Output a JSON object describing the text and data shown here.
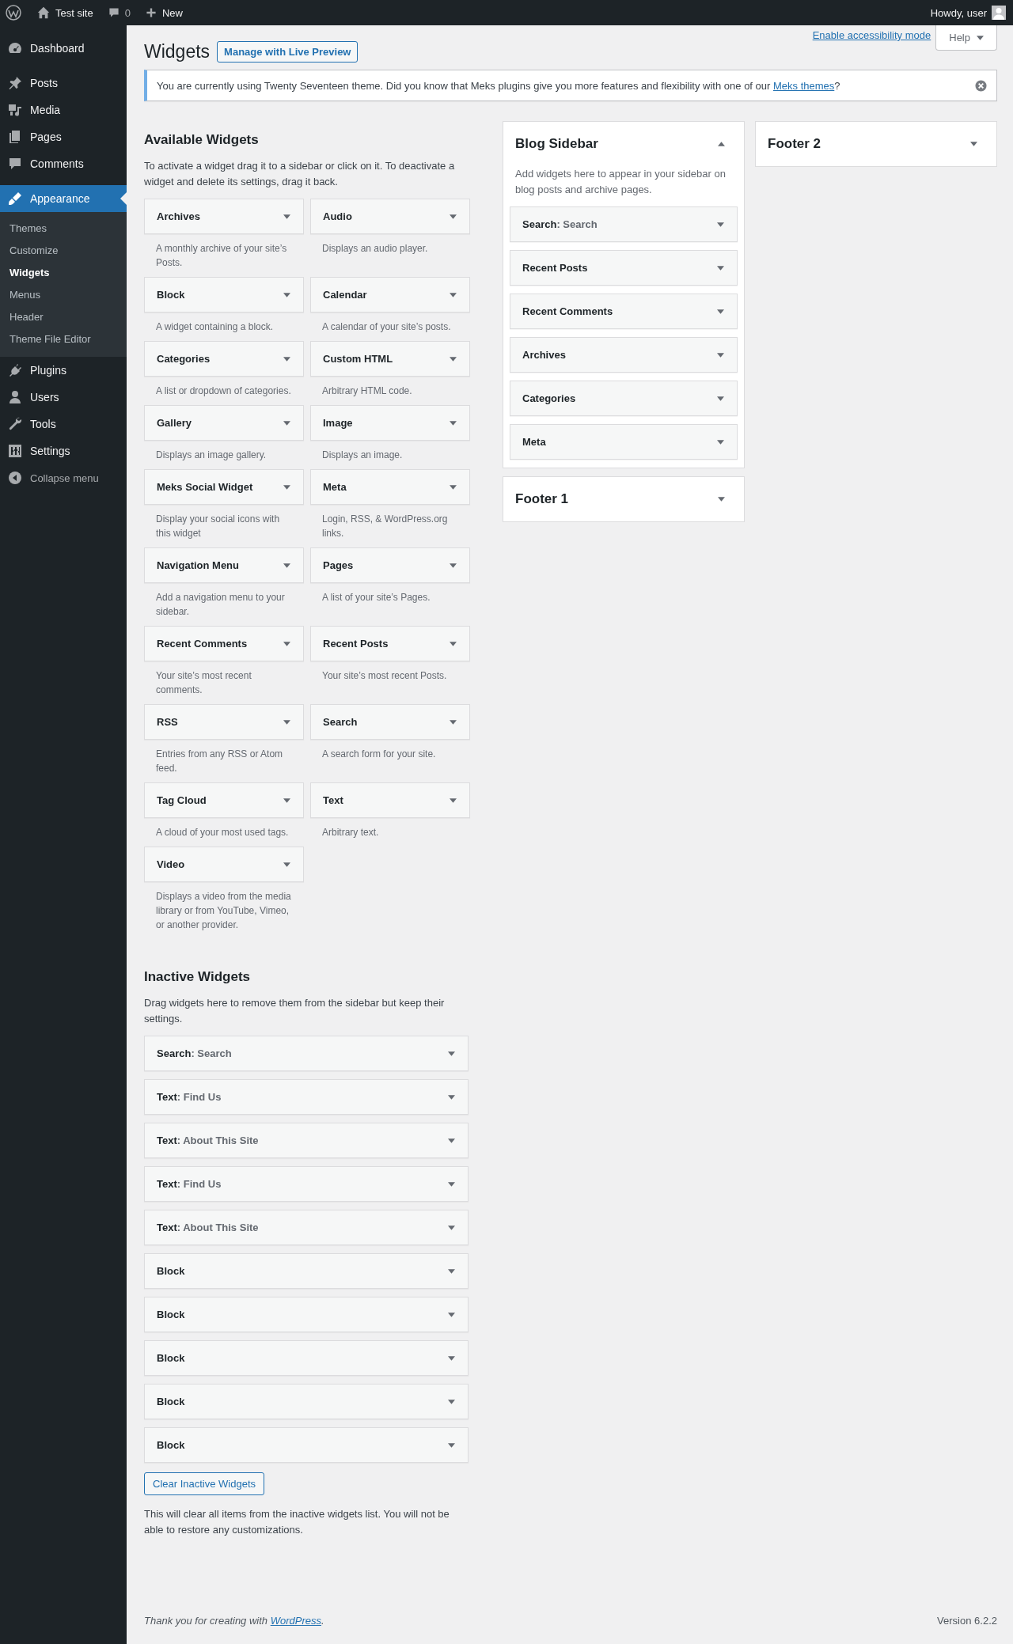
{
  "admin_bar": {
    "site_name": "Test site",
    "comments_count": "0",
    "new_label": "New",
    "greeting": "Howdy, user"
  },
  "admin_menu": {
    "items": [
      {
        "label": "Dashboard",
        "selected": false
      },
      {
        "label": "Posts",
        "selected": false
      },
      {
        "label": "Media",
        "selected": false
      },
      {
        "label": "Pages",
        "selected": false
      },
      {
        "label": "Comments",
        "selected": false
      },
      {
        "label": "Appearance",
        "selected": true,
        "children": [
          {
            "label": "Themes",
            "selected": false
          },
          {
            "label": "Customize",
            "selected": false
          },
          {
            "label": "Widgets",
            "selected": true
          },
          {
            "label": "Menus",
            "selected": false
          },
          {
            "label": "Header",
            "selected": false
          },
          {
            "label": "Theme File Editor",
            "selected": false
          }
        ]
      },
      {
        "label": "Plugins",
        "selected": false
      },
      {
        "label": "Users",
        "selected": false
      },
      {
        "label": "Tools",
        "selected": false
      },
      {
        "label": "Settings",
        "selected": false
      }
    ],
    "collapse_label": "Collapse menu"
  },
  "screen_links": {
    "accessibility_link": "Enable accessibility mode",
    "help_button": "Help"
  },
  "page": {
    "title": "Widgets",
    "live_preview_button": "Manage with Live Preview"
  },
  "notice": {
    "text_before": "You are currently using Twenty Seventeen theme. Did you know that Meks plugins give you more features and flexibility with one of our ",
    "link": "Meks themes",
    "text_after": "?"
  },
  "available": {
    "heading": "Available Widgets",
    "description": "To activate a widget drag it to a sidebar or click on it. To deactivate a widget and delete its settings, drag it back.",
    "widgets": [
      {
        "title": "Archives",
        "description": "A monthly archive of your site’s Posts."
      },
      {
        "title": "Audio",
        "description": "Displays an audio player."
      },
      {
        "title": "Block",
        "description": "A widget containing a block."
      },
      {
        "title": "Calendar",
        "description": "A calendar of your site’s posts."
      },
      {
        "title": "Categories",
        "description": "A list or dropdown of categories."
      },
      {
        "title": "Custom HTML",
        "description": "Arbitrary HTML code."
      },
      {
        "title": "Gallery",
        "description": "Displays an image gallery."
      },
      {
        "title": "Image",
        "description": "Displays an image."
      },
      {
        "title": "Meks Social Widget",
        "description": "Display your social icons with this widget"
      },
      {
        "title": "Meta",
        "description": "Login, RSS, & WordPress.org links."
      },
      {
        "title": "Navigation Menu",
        "description": "Add a navigation menu to your sidebar."
      },
      {
        "title": "Pages",
        "description": "A list of your site’s Pages."
      },
      {
        "title": "Recent Comments",
        "description": "Your site’s most recent comments."
      },
      {
        "title": "Recent Posts",
        "description": "Your site’s most recent Posts."
      },
      {
        "title": "RSS",
        "description": "Entries from any RSS or Atom feed."
      },
      {
        "title": "Search",
        "description": "A search form for your site."
      },
      {
        "title": "Tag Cloud",
        "description": "A cloud of your most used tags."
      },
      {
        "title": "Text",
        "description": "Arbitrary text."
      },
      {
        "title": "Video",
        "description": "Displays a video from the media library or from YouTube, Vimeo, or another provider."
      }
    ]
  },
  "sidebar_columns": [
    {
      "sidebars": [
        {
          "title": "Blog Sidebar",
          "expanded": true,
          "description": "Add widgets here to appear in your sidebar on blog posts and archive pages.",
          "widgets": [
            {
              "title": "Search",
              "subtitle": ": Search"
            },
            {
              "title": "Recent Posts"
            },
            {
              "title": "Recent Comments"
            },
            {
              "title": "Archives"
            },
            {
              "title": "Categories"
            },
            {
              "title": "Meta"
            }
          ]
        },
        {
          "title": "Footer 1",
          "expanded": false
        }
      ]
    },
    {
      "sidebars": [
        {
          "title": "Footer 2",
          "expanded": false
        }
      ]
    }
  ],
  "inactive": {
    "heading": "Inactive Widgets",
    "description": "Drag widgets here to remove them from the sidebar but keep their settings.",
    "widgets": [
      {
        "title": "Search",
        "subtitle": ": Search"
      },
      {
        "title": "Text",
        "subtitle": ": Find Us"
      },
      {
        "title": "Text",
        "subtitle": ": About This Site"
      },
      {
        "title": "Text",
        "subtitle": ": Find Us"
      },
      {
        "title": "Text",
        "subtitle": ": About This Site"
      },
      {
        "title": "Block"
      },
      {
        "title": "Block"
      },
      {
        "title": "Block"
      },
      {
        "title": "Block"
      },
      {
        "title": "Block"
      }
    ],
    "clear_button": "Clear Inactive Widgets",
    "clear_note": "This will clear all items from the inactive widgets list. You will not be able to restore any customizations."
  },
  "footer": {
    "thanks_before": "Thank you for creating with ",
    "link": "WordPress",
    "thanks_after": ".",
    "version": "Version 6.2.2"
  }
}
